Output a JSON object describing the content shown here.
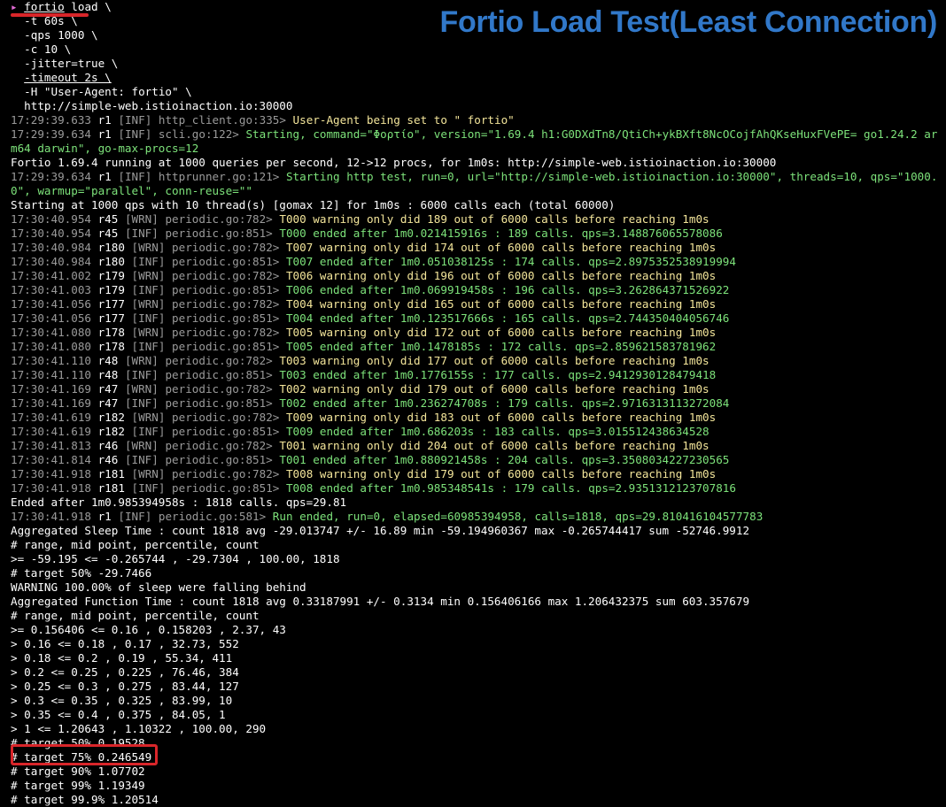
{
  "title": "Fortio Load Test(Least Connection)",
  "colors": {
    "title": "#3178c9",
    "annotation_red": "#d9262a",
    "log_green": "#7de27a",
    "log_yellow": "#f3e59a",
    "log_gray": "#9a9a9a",
    "key_magenta": "#e36bd6"
  },
  "prompt_icon": "chevron-right-icon",
  "command": {
    "prompt_symbol": "▸",
    "program": "fortio",
    "subcommand": "load \\",
    "args": [
      "-t 60s \\",
      "-qps 1000 \\",
      "-c 10 \\",
      "-jitter=true \\",
      "-timeout 2s \\",
      "-H \"User-Agent: fortio\" \\",
      "http://simple-web.istioinaction.io:30000"
    ]
  },
  "log_header": [
    {
      "time": "17:29:39.633",
      "thread": "r1",
      "level": "[INF]",
      "src": "http_client.go:335>",
      "msg": "User-Agent being set to \" fortio\""
    },
    {
      "time": "17:29:39.634",
      "thread": "r1",
      "level": "[INF]",
      "src": "scli.go:122>",
      "msg": "Starting,",
      "kv": "command=\"Φορτίο\", version=\"1.69.4 h1:G0DXdTn8/QtiCh+ykBXft8NcOCojfAhQKseHuxFVePE= go1.24.2 ar",
      "wrap": "m64 darwin\", go-max-procs=12"
    }
  ],
  "run_line": "Fortio 1.69.4 running at 1000 queries per second, 12->12 procs, for 1m0s: http://simple-web.istioinaction.io:30000",
  "http_runner": {
    "time": "17:29:39.634",
    "thread": "r1",
    "level": "[INF]",
    "src": "httprunner.go:121>",
    "msg": "Starting http test,",
    "kv": "run=0, url=\"http://simple-web.istioinaction.io:30000\", threads=10, qps=\"1000.",
    "wrap": "0\", warmup=\"parallel\", conn-reuse=\"\""
  },
  "start_line": "Starting at 1000 qps with 10 thread(s) [gomax 12] for 1m0s : 6000 calls each (total 60000)",
  "periodic_logs": [
    {
      "time": "17:30:40.954",
      "thread": "r45",
      "level": "[WRN]",
      "src": "periodic.go:782>",
      "msg": "T000 warning only did 189 out of 6000 calls before reaching 1m0s",
      "kind": "warn"
    },
    {
      "time": "17:30:40.954",
      "thread": "r45",
      "level": "[INF]",
      "src": "periodic.go:851>",
      "msg": "T000 ended after 1m0.021415916s : 189 calls. qps=3.148876065578086",
      "kind": "info"
    },
    {
      "time": "17:30:40.984",
      "thread": "r180",
      "level": "[WRN]",
      "src": "periodic.go:782>",
      "msg": "T007 warning only did 174 out of 6000 calls before reaching 1m0s",
      "kind": "warn"
    },
    {
      "time": "17:30:40.984",
      "thread": "r180",
      "level": "[INF]",
      "src": "periodic.go:851>",
      "msg": "T007 ended after 1m0.051038125s : 174 calls. qps=2.8975352538919994",
      "kind": "info"
    },
    {
      "time": "17:30:41.002",
      "thread": "r179",
      "level": "[WRN]",
      "src": "periodic.go:782>",
      "msg": "T006 warning only did 196 out of 6000 calls before reaching 1m0s",
      "kind": "warn"
    },
    {
      "time": "17:30:41.003",
      "thread": "r179",
      "level": "[INF]",
      "src": "periodic.go:851>",
      "msg": "T006 ended after 1m0.069919458s : 196 calls. qps=3.262864371526922",
      "kind": "info"
    },
    {
      "time": "17:30:41.056",
      "thread": "r177",
      "level": "[WRN]",
      "src": "periodic.go:782>",
      "msg": "T004 warning only did 165 out of 6000 calls before reaching 1m0s",
      "kind": "warn"
    },
    {
      "time": "17:30:41.056",
      "thread": "r177",
      "level": "[INF]",
      "src": "periodic.go:851>",
      "msg": "T004 ended after 1m0.123517666s : 165 calls. qps=2.744350404056746",
      "kind": "info"
    },
    {
      "time": "17:30:41.080",
      "thread": "r178",
      "level": "[WRN]",
      "src": "periodic.go:782>",
      "msg": "T005 warning only did 172 out of 6000 calls before reaching 1m0s",
      "kind": "warn"
    },
    {
      "time": "17:30:41.080",
      "thread": "r178",
      "level": "[INF]",
      "src": "periodic.go:851>",
      "msg": "T005 ended after 1m0.1478185s : 172 calls. qps=2.859621583781962",
      "kind": "info"
    },
    {
      "time": "17:30:41.110",
      "thread": "r48",
      "level": "[WRN]",
      "src": "periodic.go:782>",
      "msg": "T003 warning only did 177 out of 6000 calls before reaching 1m0s",
      "kind": "warn"
    },
    {
      "time": "17:30:41.110",
      "thread": "r48",
      "level": "[INF]",
      "src": "periodic.go:851>",
      "msg": "T003 ended after 1m0.1776155s : 177 calls. qps=2.9412930128479418",
      "kind": "info"
    },
    {
      "time": "17:30:41.169",
      "thread": "r47",
      "level": "[WRN]",
      "src": "periodic.go:782>",
      "msg": "T002 warning only did 179 out of 6000 calls before reaching 1m0s",
      "kind": "warn"
    },
    {
      "time": "17:30:41.169",
      "thread": "r47",
      "level": "[INF]",
      "src": "periodic.go:851>",
      "msg": "T002 ended after 1m0.236274708s : 179 calls. qps=2.9716313113272084",
      "kind": "info"
    },
    {
      "time": "17:30:41.619",
      "thread": "r182",
      "level": "[WRN]",
      "src": "periodic.go:782>",
      "msg": "T009 warning only did 183 out of 6000 calls before reaching 1m0s",
      "kind": "warn"
    },
    {
      "time": "17:30:41.619",
      "thread": "r182",
      "level": "[INF]",
      "src": "periodic.go:851>",
      "msg": "T009 ended after 1m0.686203s : 183 calls. qps=3.015512438634528",
      "kind": "info"
    },
    {
      "time": "17:30:41.813",
      "thread": "r46",
      "level": "[WRN]",
      "src": "periodic.go:782>",
      "msg": "T001 warning only did 204 out of 6000 calls before reaching 1m0s",
      "kind": "warn"
    },
    {
      "time": "17:30:41.814",
      "thread": "r46",
      "level": "[INF]",
      "src": "periodic.go:851>",
      "msg": "T001 ended after 1m0.880921458s : 204 calls. qps=3.3508034227230565",
      "kind": "info"
    },
    {
      "time": "17:30:41.918",
      "thread": "r181",
      "level": "[WRN]",
      "src": "periodic.go:782>",
      "msg": "T008 warning only did 179 out of 6000 calls before reaching 1m0s",
      "kind": "warn"
    },
    {
      "time": "17:30:41.918",
      "thread": "r181",
      "level": "[INF]",
      "src": "periodic.go:851>",
      "msg": "T008 ended after 1m0.985348541s : 179 calls. qps=2.9351312123707816",
      "kind": "info"
    }
  ],
  "ended_line": "Ended after 1m0.985394958s : 1818 calls. qps=29.81",
  "run_ended": {
    "time": "17:30:41.918",
    "thread": "r1",
    "level": "[INF]",
    "src": "periodic.go:581>",
    "msg": "Run ended,",
    "kv": "run=0, elapsed=60985394958, calls=1818, qps=29.810416104577783"
  },
  "summary_lines": [
    "Aggregated Sleep Time : count 1818 avg -29.013747 +/- 16.89 min -59.194960367 max -0.265744417 sum -52746.9912",
    "# range, mid point, percentile, count",
    ">= -59.195 <= -0.265744 , -29.7304 , 100.00, 1818",
    "# target 50% -29.7466",
    "WARNING 100.00% of sleep were falling behind",
    "Aggregated Function Time : count 1818 avg 0.33187991 +/- 0.3134 min 0.156406166 max 1.206432375 sum 603.357679",
    "# range, mid point, percentile, count",
    ">= 0.156406 <= 0.16 , 0.158203 , 2.37, 43",
    "> 0.16 <= 0.18 , 0.17 , 32.73, 552",
    "> 0.18 <= 0.2 , 0.19 , 55.34, 411",
    "> 0.2 <= 0.25 , 0.225 , 76.46, 384",
    "> 0.25 <= 0.3 , 0.275 , 83.44, 127",
    "> 0.3 <= 0.35 , 0.325 , 83.99, 10",
    "> 0.35 <= 0.4 , 0.375 , 84.05, 1",
    "> 1 <= 1.20643 , 1.10322 , 100.00, 290",
    "# target 50% 0.19528",
    "# target 75% 0.246549",
    "# target 90% 1.07702",
    "# target 99% 1.19349",
    "# target 99.9% 1.20514"
  ]
}
